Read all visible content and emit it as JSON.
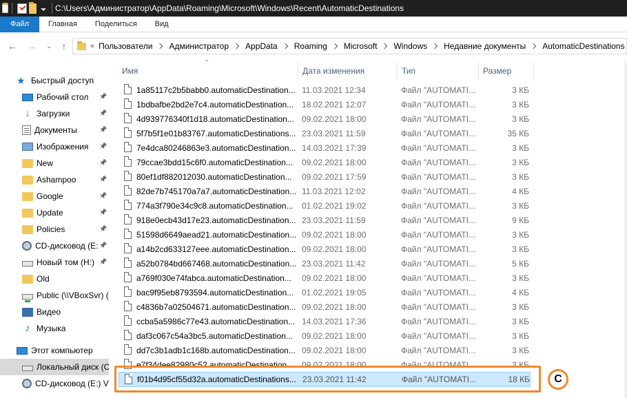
{
  "window": {
    "title": "C:\\Users\\Администратор\\AppData\\Roaming\\Microsoft\\Windows\\Recent\\AutomaticDestinations"
  },
  "ribbon": {
    "tabs": [
      "Файл",
      "Главная",
      "Поделиться",
      "Вид"
    ]
  },
  "address": {
    "overflow": "«",
    "crumbs": [
      "Пользователи",
      "Администратор",
      "AppData",
      "Roaming",
      "Microsoft",
      "Windows",
      "Недавние документы",
      "AutomaticDestinations"
    ]
  },
  "sidebar": {
    "quick_access": "Быстрый доступ",
    "items": [
      {
        "label": "Рабочий стол",
        "icon": "desktop-icon",
        "pinned": true
      },
      {
        "label": "Загрузки",
        "icon": "downloads-icon",
        "pinned": true
      },
      {
        "label": "Документы",
        "icon": "documents-icon",
        "pinned": true
      },
      {
        "label": "Изображения",
        "icon": "pictures-icon",
        "pinned": true
      },
      {
        "label": "New",
        "icon": "folder-icon",
        "pinned": true
      },
      {
        "label": "Ashampoo",
        "icon": "folder-icon",
        "pinned": true
      },
      {
        "label": "Google",
        "icon": "folder-icon",
        "pinned": true
      },
      {
        "label": "Update",
        "icon": "folder-icon",
        "pinned": true
      },
      {
        "label": "Policies",
        "icon": "folder-icon",
        "pinned": true
      },
      {
        "label": "CD-дисковод (E:",
        "icon": "cd-drive-icon",
        "pinned": true
      },
      {
        "label": "Новый том (H:)",
        "icon": "disk-icon",
        "pinned": true
      },
      {
        "label": "Old",
        "icon": "folder-icon",
        "pinned": false
      },
      {
        "label": "Public (\\\\VBoxSvr) (",
        "icon": "network-drive-icon",
        "pinned": false
      },
      {
        "label": "Видео",
        "icon": "video-icon",
        "pinned": false
      },
      {
        "label": "Музыка",
        "icon": "music-icon",
        "pinned": false
      }
    ],
    "this_pc": "Этот компьютер",
    "pc_items": [
      {
        "label": "Локальный диск (C",
        "icon": "local-disk-icon",
        "selected": true
      },
      {
        "label": "CD-дисковод (E:) V",
        "icon": "cd-drive-icon",
        "selected": false
      }
    ]
  },
  "columns": {
    "name": "Имя",
    "date": "Дата изменения",
    "type": "Тип",
    "size": "Размер"
  },
  "files": [
    {
      "name": "1a85117c2b5babb0.automaticDestination...",
      "date": "11.03.2021 12:34",
      "type": "Файл \"AUTOMATI...",
      "size": "3 КБ"
    },
    {
      "name": "1bdbafbe2bd2e7c4.automaticDestination...",
      "date": "18.02.2021 12:07",
      "type": "Файл \"AUTOMATI...",
      "size": "3 КБ"
    },
    {
      "name": "4d939776340f1d18.automaticDestination...",
      "date": "09.02.2021 18:00",
      "type": "Файл \"AUTOMATI...",
      "size": "3 КБ"
    },
    {
      "name": "5f7b5f1e01b83767.automaticDestinations...",
      "date": "23.03.2021 11:59",
      "type": "Файл \"AUTOMATI...",
      "size": "35 КБ"
    },
    {
      "name": "7e4dca80246863e3.automaticDestination...",
      "date": "14.03.2021 17:39",
      "type": "Файл \"AUTOMATI...",
      "size": "3 КБ"
    },
    {
      "name": "79ccae3bdd15c6f0.automaticDestination...",
      "date": "09.02.2021 18:00",
      "type": "Файл \"AUTOMATI...",
      "size": "3 КБ"
    },
    {
      "name": "80ef1df882012030.automaticDestination...",
      "date": "09.02.2021 17:59",
      "type": "Файл \"AUTOMATI...",
      "size": "3 КБ"
    },
    {
      "name": "82de7b745170a7a7.automaticDestination...",
      "date": "11.03.2021 12:02",
      "type": "Файл \"AUTOMATI...",
      "size": "4 КБ"
    },
    {
      "name": "774a3f790e34c9c8.automaticDestination...",
      "date": "01.02.2021 19:02",
      "type": "Файл \"AUTOMATI...",
      "size": "3 КБ"
    },
    {
      "name": "918e0ecb43d17e23.automaticDestination...",
      "date": "23.03.2021 11:59",
      "type": "Файл \"AUTOMATI...",
      "size": "9 КБ"
    },
    {
      "name": "51598d6649aead21.automaticDestination...",
      "date": "09.02.2021 18:00",
      "type": "Файл \"AUTOMATI...",
      "size": "3 КБ"
    },
    {
      "name": "a14b2cd633127eee.automaticDestination...",
      "date": "09.02.2021 18:00",
      "type": "Файл \"AUTOMATI...",
      "size": "3 КБ"
    },
    {
      "name": "a52b0784bd667468.automaticDestination...",
      "date": "23.03.2021 11:42",
      "type": "Файл \"AUTOMATI...",
      "size": "5 КБ"
    },
    {
      "name": "a769f030e74fabca.automaticDestination...",
      "date": "09.02.2021 18:00",
      "type": "Файл \"AUTOMATI...",
      "size": "3 КБ"
    },
    {
      "name": "bac9f95eb8793594.automaticDestination...",
      "date": "01.02.2021 19:05",
      "type": "Файл \"AUTOMATI...",
      "size": "4 КБ"
    },
    {
      "name": "c4836b7a02504671.automaticDestination...",
      "date": "09.02.2021 18:00",
      "type": "Файл \"AUTOMATI...",
      "size": "3 КБ"
    },
    {
      "name": "ccba5a5986c77e43.automaticDestination...",
      "date": "14.03.2021 17:36",
      "type": "Файл \"AUTOMATI...",
      "size": "3 КБ"
    },
    {
      "name": "daf3c067c54a3bc5.automaticDestination...",
      "date": "09.02.2021 18:00",
      "type": "Файл \"AUTOMATI...",
      "size": "3 КБ"
    },
    {
      "name": "dd7c3b1adb1c168b.automaticDestination...",
      "date": "09.02.2021 18:00",
      "type": "Файл \"AUTOMATI...",
      "size": "3 КБ"
    },
    {
      "name": "e7f34dee82980c52.automaticDestination...",
      "date": "09.02.2021 18:00",
      "type": "Файл \"AUTOMATI...",
      "size": "3 КБ"
    },
    {
      "name": "f01b4d95cf55d32a.automaticDestinations...",
      "date": "23.03.2021 11:42",
      "type": "Файл \"AUTOMATI...",
      "size": "18 КБ",
      "selected": true
    }
  ],
  "annotation": {
    "badge": "C",
    "color": "#f0892a"
  },
  "colors": {
    "title_bar": "#1f1f1f",
    "file_tab": "#1979ca",
    "selection": "#cce8ff"
  }
}
